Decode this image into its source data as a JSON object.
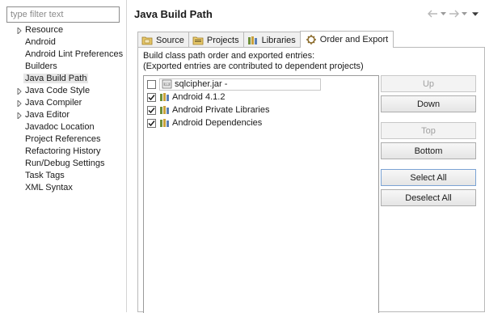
{
  "sidebar": {
    "filter_placeholder": "type filter text",
    "items": [
      {
        "label": "Resource",
        "expandable": true
      },
      {
        "label": "Android",
        "expandable": false
      },
      {
        "label": "Android Lint Preferences",
        "expandable": false
      },
      {
        "label": "Builders",
        "expandable": false
      },
      {
        "label": "Java Build Path",
        "expandable": false,
        "selected": true
      },
      {
        "label": "Java Code Style",
        "expandable": true
      },
      {
        "label": "Java Compiler",
        "expandable": true
      },
      {
        "label": "Java Editor",
        "expandable": true
      },
      {
        "label": "Javadoc Location",
        "expandable": false
      },
      {
        "label": "Project References",
        "expandable": false
      },
      {
        "label": "Refactoring History",
        "expandable": false
      },
      {
        "label": "Run/Debug Settings",
        "expandable": false
      },
      {
        "label": "Task Tags",
        "expandable": false
      },
      {
        "label": "XML Syntax",
        "expandable": false
      }
    ]
  },
  "header": {
    "title": "Java Build Path",
    "nav_icons": [
      "back-arrow-icon",
      "dropdown-icon",
      "forward-arrow-icon",
      "dropdown-icon",
      "view-menu-icon"
    ]
  },
  "tabs": [
    {
      "label": "Source",
      "icon": "source-folder-icon"
    },
    {
      "label": "Projects",
      "icon": "projects-icon"
    },
    {
      "label": "Libraries",
      "icon": "libraries-icon"
    },
    {
      "label": "Order and Export",
      "icon": "order-export-icon",
      "active": true
    }
  ],
  "order_export": {
    "description_line1": "Build class path order and exported entries:",
    "description_line2": "(Exported entries are contributed to dependent projects)",
    "entries": [
      {
        "label": "sqlcipher.jar -",
        "checked": false,
        "icon": "jar-icon",
        "editing": true
      },
      {
        "label": "Android 4.1.2",
        "checked": true,
        "icon": "library-icon"
      },
      {
        "label": "Android Private Libraries",
        "checked": true,
        "icon": "library-icon"
      },
      {
        "label": "Android Dependencies",
        "checked": true,
        "icon": "library-icon"
      }
    ],
    "buttons": {
      "up": "Up",
      "down": "Down",
      "top": "Top",
      "bottom": "Bottom",
      "select_all": "Select All",
      "deselect_all": "Deselect All"
    }
  },
  "colors": {
    "selection": "#e6e6e6",
    "accent": "#7ba3d4",
    "disabled_text": "#a0a0a0"
  }
}
